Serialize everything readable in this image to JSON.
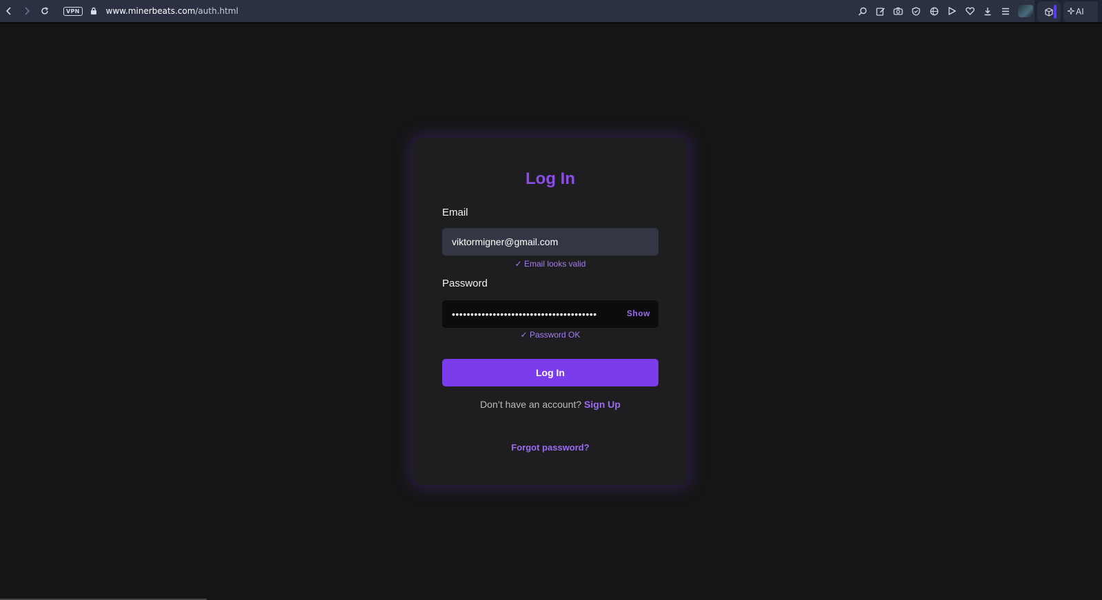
{
  "browser": {
    "vpn_label": "VPN",
    "url_host": "www.minerbeats.com",
    "url_path": "/auth.html",
    "ai_label": "AI"
  },
  "auth": {
    "title": "Log In",
    "email_label": "Email",
    "email_value": "viktormigner@gmail.com",
    "email_hint": "✓ Email looks valid",
    "password_label": "Password",
    "password_masked": "•••••••••••••••••••••••••••••••••••••••",
    "show_label": "Show",
    "password_hint": "✓ Password OK",
    "login_button": "Log In",
    "signup_prompt": "Don’t have an account?",
    "signup_link": "Sign Up",
    "forgot_link": "Forgot password?"
  },
  "colors": {
    "accent": "#7b3cec",
    "accent_text": "#9b6cf0",
    "page_bg": "#151515",
    "card_bg": "#1e1e20"
  }
}
